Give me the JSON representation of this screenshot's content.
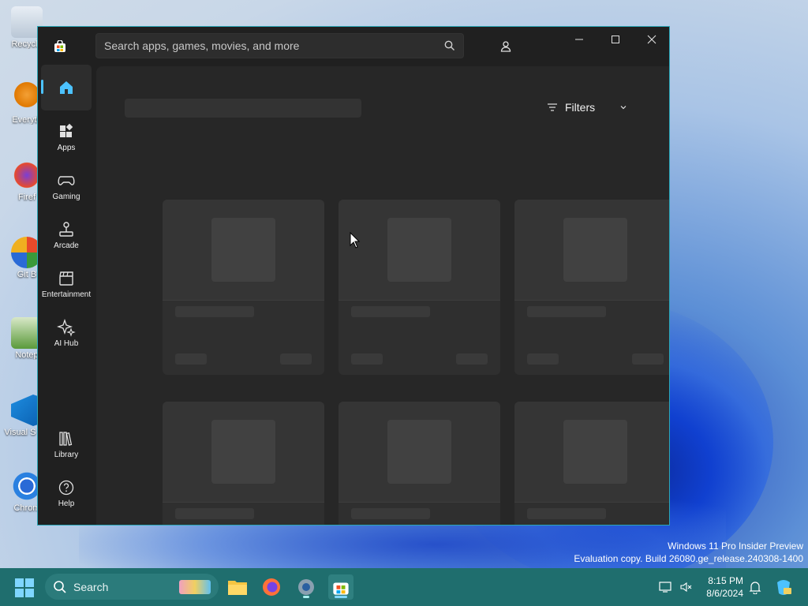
{
  "desktop": {
    "icons": [
      {
        "label": "Recycle",
        "icon": "recycle-bin-icon"
      },
      {
        "label": "Everyth",
        "icon": "everything-search-icon"
      },
      {
        "label": "Firef",
        "icon": "firefox-icon"
      },
      {
        "label": "Git B",
        "icon": "git-bash-icon"
      },
      {
        "label": "Notep",
        "icon": "notepad-icon"
      },
      {
        "label": "Visual S Co",
        "icon": "vscode-icon"
      },
      {
        "label": "Chrom",
        "icon": "chrome-icon"
      }
    ],
    "watermark": {
      "line1": "Windows 11 Pro Insider Preview",
      "line2": "Evaluation copy. Build 26080.ge_release.240308-1400"
    }
  },
  "store": {
    "search": {
      "placeholder": "Search apps, games, movies, and more"
    },
    "nav": [
      {
        "label": "",
        "icon": "home-icon",
        "active": true
      },
      {
        "label": "Apps",
        "icon": "apps-icon"
      },
      {
        "label": "Gaming",
        "icon": "gamepad-icon"
      },
      {
        "label": "Arcade",
        "icon": "joystick-icon"
      },
      {
        "label": "Entertainment",
        "icon": "clapperboard-icon"
      },
      {
        "label": "AI Hub",
        "icon": "sparkle-icon"
      },
      {
        "label": "Library",
        "icon": "library-icon"
      },
      {
        "label": "Help",
        "icon": "help-icon"
      }
    ],
    "filters_label": "Filters",
    "accent": "#4cc2ff"
  },
  "taskbar": {
    "search_label": "Search",
    "time": "8:15 PM",
    "date": "8/6/2024"
  }
}
